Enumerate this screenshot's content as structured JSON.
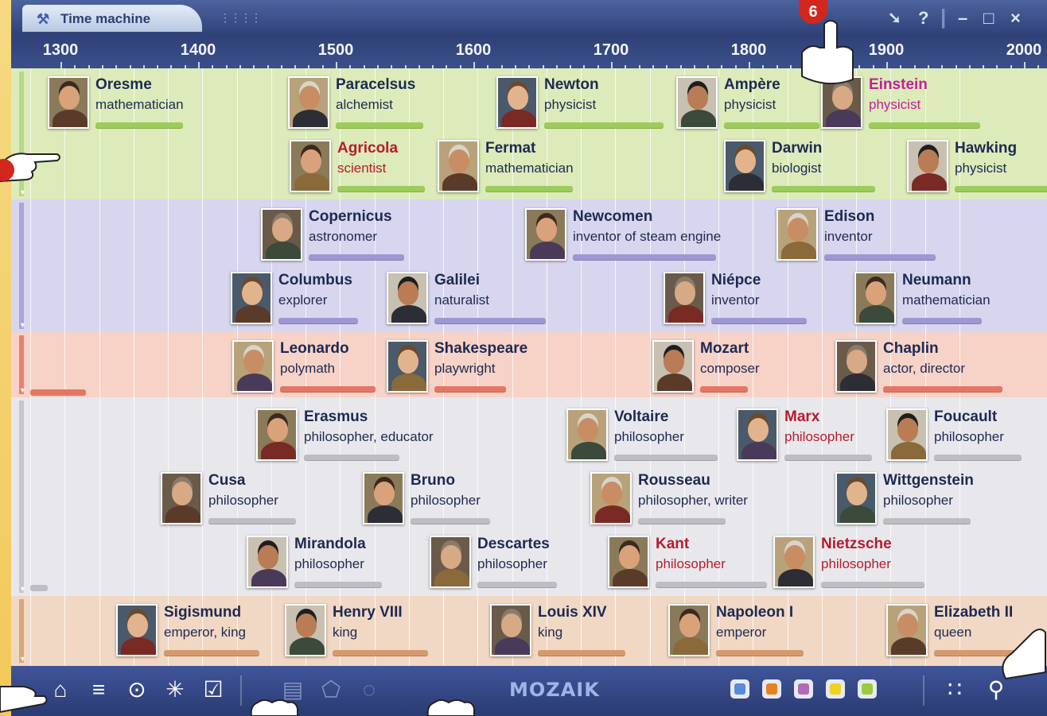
{
  "window": {
    "title": "Time machine",
    "logo": "MOZAIK",
    "badge": "6"
  },
  "controls": {
    "pin": "pin-icon",
    "help": "?",
    "minimize": "–",
    "maximize": "□",
    "close": "×"
  },
  "ruler": {
    "years": [
      "1300",
      "1400",
      "1500",
      "1600",
      "1700",
      "1800",
      "1900",
      "2000"
    ]
  },
  "bands": [
    {
      "id": "science",
      "color": "#dcebb9",
      "bar": "#9ccc5a",
      "side": "#b5d88a"
    },
    {
      "id": "invention",
      "color": "#d7d6ee",
      "bar": "#9d97d2",
      "side": "#a9a6da"
    },
    {
      "id": "arts",
      "color": "#f7d2c7",
      "bar": "#e47666",
      "side": "#e9806f"
    },
    {
      "id": "philosophy",
      "color": "#e8e8ec",
      "bar": "#bdbdc2",
      "side": "#c6c6cc"
    },
    {
      "id": "rulers",
      "color": "#f1d8c4",
      "bar": "#d49a6e",
      "side": "#d9a67c"
    }
  ],
  "people": [
    {
      "name": "Oresme",
      "role": "mathematician",
      "band": 0
    },
    {
      "name": "Paracelsus",
      "role": "alchemist",
      "band": 0
    },
    {
      "name": "Newton",
      "role": "physicist",
      "band": 0
    },
    {
      "name": "Ampère",
      "role": "physicist",
      "band": 0
    },
    {
      "name": "Einstein",
      "role": "physicist",
      "band": 0
    },
    {
      "name": "Agricola",
      "role": "scientist",
      "band": 0
    },
    {
      "name": "Fermat",
      "role": "mathematician",
      "band": 0
    },
    {
      "name": "Darwin",
      "role": "biologist",
      "band": 0
    },
    {
      "name": "Hawking",
      "role": "physicist",
      "band": 0
    },
    {
      "name": "Copernicus",
      "role": "astronomer",
      "band": 1
    },
    {
      "name": "Newcomen",
      "role": "inventor of steam engine",
      "band": 1
    },
    {
      "name": "Edison",
      "role": "inventor",
      "band": 1
    },
    {
      "name": "Columbus",
      "role": "explorer",
      "band": 1
    },
    {
      "name": "Galilei",
      "role": "naturalist",
      "band": 1
    },
    {
      "name": "Niépce",
      "role": "inventor",
      "band": 1
    },
    {
      "name": "Neumann",
      "role": "mathematician",
      "band": 1
    },
    {
      "name": "Leonardo",
      "role": "polymath",
      "band": 2
    },
    {
      "name": "Shakespeare",
      "role": "playwright",
      "band": 2
    },
    {
      "name": "Mozart",
      "role": "composer",
      "band": 2
    },
    {
      "name": "Chaplin",
      "role": "actor, director",
      "band": 2
    },
    {
      "name": "Erasmus",
      "role": "philosopher, educator",
      "band": 3
    },
    {
      "name": "Voltaire",
      "role": "philosopher",
      "band": 3
    },
    {
      "name": "Marx",
      "role": "philosopher",
      "band": 3
    },
    {
      "name": "Foucault",
      "role": "philosopher",
      "band": 3
    },
    {
      "name": "Cusa",
      "role": "philosopher",
      "band": 3
    },
    {
      "name": "Bruno",
      "role": "philosopher",
      "band": 3
    },
    {
      "name": "Rousseau",
      "role": "philosopher, writer",
      "band": 3
    },
    {
      "name": "Wittgenstein",
      "role": "philosopher",
      "band": 3
    },
    {
      "name": "Mirandola",
      "role": "philosopher",
      "band": 3
    },
    {
      "name": "Descartes",
      "role": "philosopher",
      "band": 3
    },
    {
      "name": "Kant",
      "role": "philosopher",
      "band": 3
    },
    {
      "name": "Nietzsche",
      "role": "philosopher",
      "band": 3
    },
    {
      "name": "Sigismund",
      "role": "emperor, king",
      "band": 4
    },
    {
      "name": "Henry VIII",
      "role": "king",
      "band": 4
    },
    {
      "name": "Louis XIV",
      "role": "king",
      "band": 4
    },
    {
      "name": "Napoleon I",
      "role": "emperor",
      "band": 4
    },
    {
      "name": "Elizabeth II",
      "role": "queen",
      "band": 4
    }
  ],
  "toolbar": {
    "left": [
      "home-icon",
      "list-icon",
      "target-icon",
      "sparkle-icon",
      "checklist-icon"
    ],
    "mid": [
      "card-icon",
      "pentagon-icon",
      "dotted-circle-icon"
    ],
    "filters": [
      "#5a8ad8",
      "#e8821e",
      "#b06ab8",
      "#f0d21e",
      "#9ccc3c"
    ],
    "right": [
      "grid-icon",
      "search-icon"
    ]
  }
}
